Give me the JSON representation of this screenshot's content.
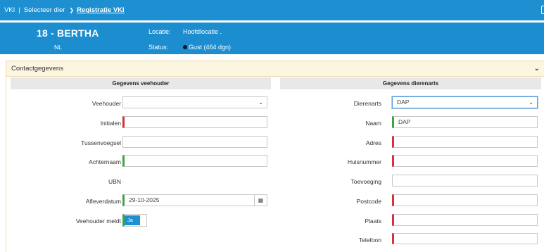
{
  "breadcrumb": {
    "root": "VKI",
    "separator": "|",
    "step": "Selecteer dier",
    "chevron": "❯",
    "current": "Registratie VKI"
  },
  "animal": {
    "name": "18 - BERTHA",
    "country": "NL",
    "location_label": "Locatie:",
    "location_value": "Hoofdlocatie .",
    "status_label": "Status:",
    "status_value": "Gust (464 dgn)"
  },
  "panel": {
    "title": "Contactgegevens",
    "chevron": "⌄"
  },
  "owner": {
    "heading": "Gegevens veehouder",
    "fields": [
      {
        "label": "Veehouder",
        "value": ""
      },
      {
        "label": "Initialen",
        "value": ""
      },
      {
        "label": "Tussenvoegsel",
        "value": ""
      },
      {
        "label": "Achternaam",
        "value": ""
      },
      {
        "label": "UBN",
        "value": "."
      },
      {
        "label": "Afleverdatum",
        "value": "29-10-2025"
      },
      {
        "label": "Veehouder meldt",
        "value": "Ja"
      }
    ]
  },
  "vet": {
    "heading": "Gegevens dierenarts",
    "fields": [
      {
        "label": "Dierenarts",
        "value": "DAP"
      },
      {
        "label": "Naam",
        "value": "DAP"
      },
      {
        "label": "Adres",
        "value": ""
      },
      {
        "label": "Huisnummer",
        "value": ""
      },
      {
        "label": "Toevoeging",
        "value": ""
      },
      {
        "label": "Postcode",
        "value": ""
      },
      {
        "label": "Plaats",
        "value": ""
      },
      {
        "label": "Telefoon",
        "value": ""
      }
    ]
  },
  "icons": {
    "select_caret": "⌄",
    "calendar": "▦"
  },
  "colors": {
    "primary": "#1e8fd1",
    "required": "#d7323c",
    "valid": "#3ea545",
    "panel_header_bg": "#fcf5df"
  }
}
